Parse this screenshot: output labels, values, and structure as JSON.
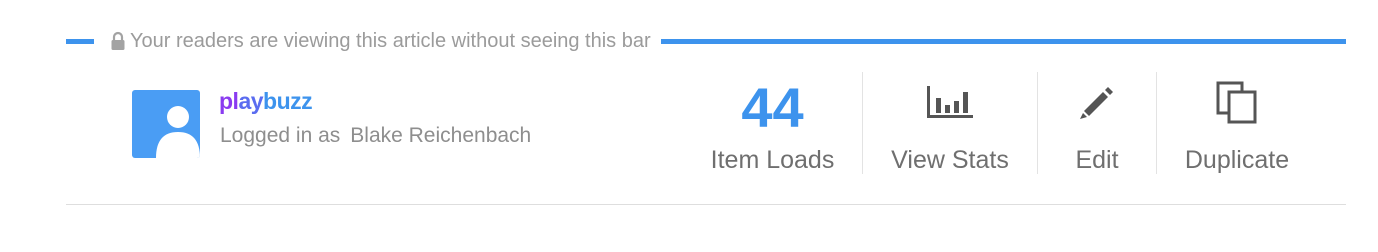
{
  "notice": {
    "text": "Your readers are viewing this article without seeing this bar",
    "icon": "lock-icon",
    "accent_color": "#3d93ed"
  },
  "user": {
    "brand_part1": "pl",
    "brand_part2": "ay",
    "brand_part3": "buzz",
    "logged_in_prefix": "Logged in as",
    "username": "Blake Reichenbach",
    "avatar_icon": "user-avatar-icon"
  },
  "stats": {
    "item_loads_count": "44",
    "item_loads_label": "Item Loads"
  },
  "actions": {
    "view_stats_label": "View Stats",
    "view_stats_icon": "bar-chart-icon",
    "edit_label": "Edit",
    "edit_icon": "pencil-icon",
    "duplicate_label": "Duplicate",
    "duplicate_icon": "duplicate-icon"
  }
}
